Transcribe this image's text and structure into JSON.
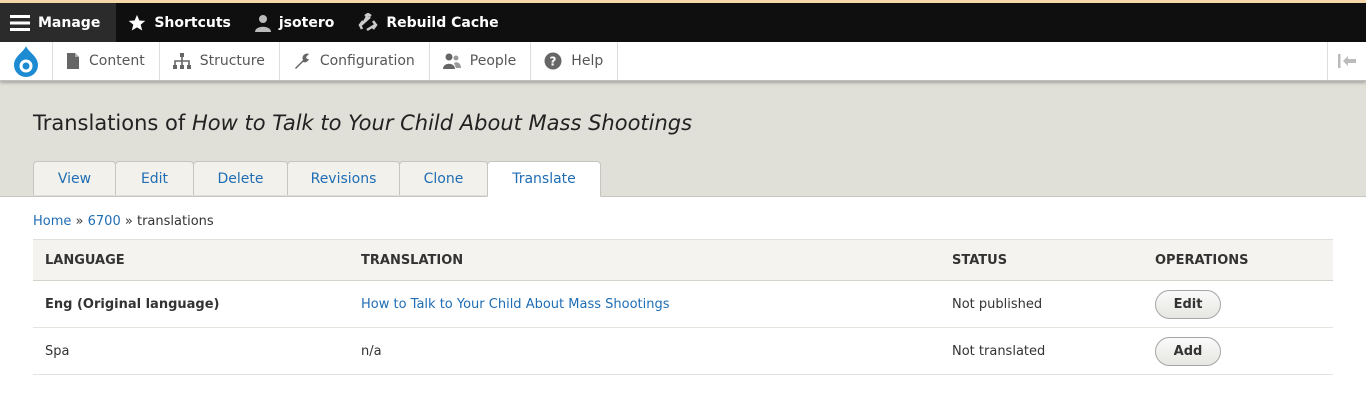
{
  "toolbar": {
    "manage": "Manage",
    "shortcuts": "Shortcuts",
    "user": "jsotero",
    "rebuild": "Rebuild Cache"
  },
  "tray": {
    "items": [
      {
        "label": "Content",
        "icon": "file-icon"
      },
      {
        "label": "Structure",
        "icon": "structure-icon"
      },
      {
        "label": "Configuration",
        "icon": "wrench-icon"
      },
      {
        "label": "People",
        "icon": "people-icon"
      },
      {
        "label": "Help",
        "icon": "help-icon"
      }
    ]
  },
  "page": {
    "title_prefix": "Translations of",
    "title_italic": "How to Talk to Your Child About Mass Shootings"
  },
  "tabs": [
    "View",
    "Edit",
    "Delete",
    "Revisions",
    "Clone",
    "Translate"
  ],
  "active_tab": "Translate",
  "breadcrumb": {
    "home": "Home",
    "sep": "»",
    "node": "6700",
    "current": "translations"
  },
  "table": {
    "headers": [
      "LANGUAGE",
      "TRANSLATION",
      "STATUS",
      "OPERATIONS"
    ],
    "rows": [
      {
        "language": "Eng (Original language)",
        "translation": "How to Talk to Your Child About Mass Shootings",
        "status": "Not published",
        "operation": "Edit"
      },
      {
        "language": "Spa",
        "translation": "n/a",
        "status": "Not translated",
        "operation": "Add"
      }
    ]
  },
  "colors": {
    "link": "#1f6db4",
    "toolbar": "#0f0f0f",
    "header_bg": "#e0e0d8"
  }
}
